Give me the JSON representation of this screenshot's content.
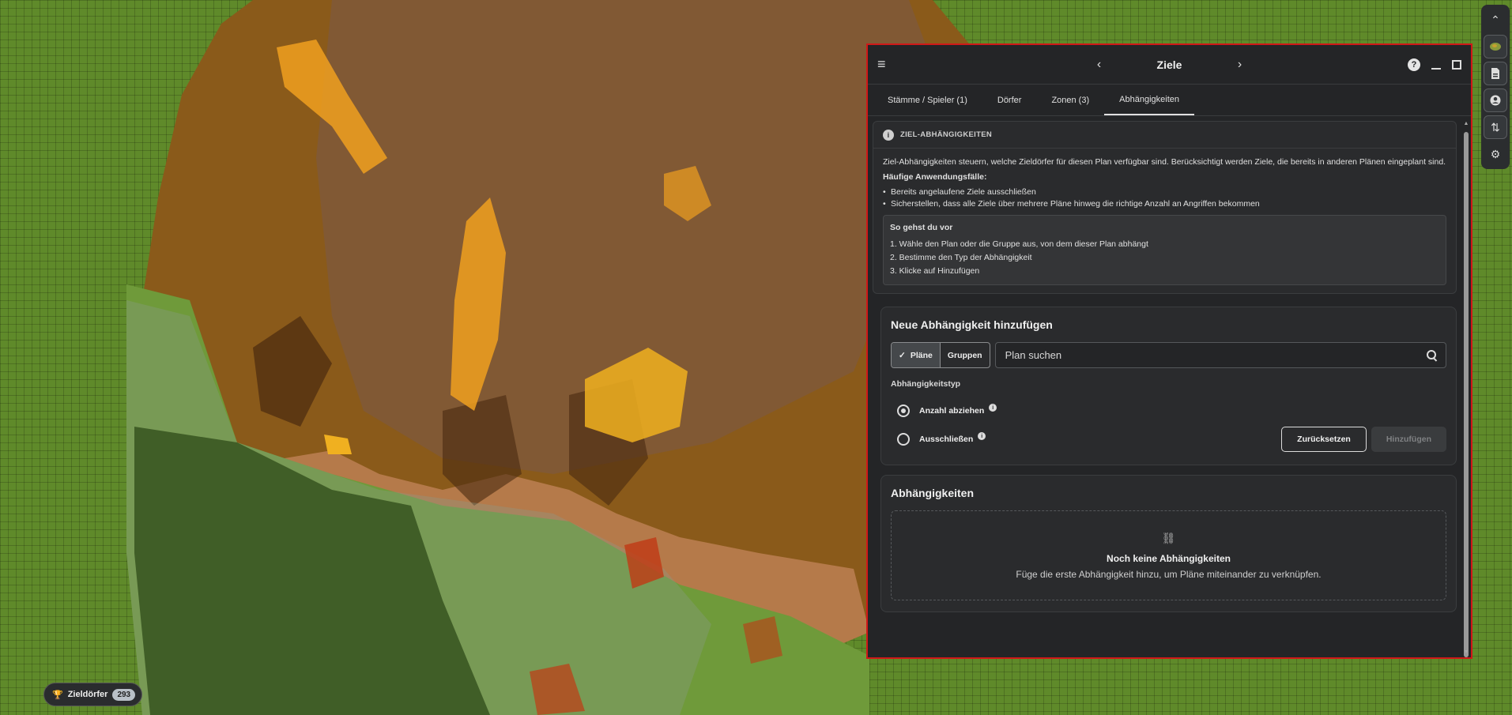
{
  "colors": {
    "panel_border": "#d01818",
    "map_green": "#5f8a2a",
    "map_brown": "#8a5a1a",
    "map_orange": "#f0a020"
  },
  "map_badge": {
    "icon": "trophy-icon",
    "label": "Zieldörfer",
    "count": "293"
  },
  "right_toolbar": {
    "icons": [
      "chevron-up-icon",
      "map-preview-icon",
      "document-icon",
      "account-icon",
      "swap-icon",
      "settings-icon"
    ]
  },
  "panel": {
    "title": "Ziele",
    "tabs": [
      {
        "label": "Stämme / Spieler (1)"
      },
      {
        "label": "Dörfer"
      },
      {
        "label": "Zonen (3)"
      },
      {
        "label": "Abhängigkeiten",
        "active": true
      }
    ],
    "info": {
      "heading": "ZIEL-ABHÄNGIGKEITEN",
      "description": "Ziel-Abhängigkeiten steuern, welche Zieldörfer für diesen Plan verfügbar sind. Berücksichtigt werden Ziele, die bereits in anderen Plänen eingeplant sind.",
      "use_cases_title": "Häufige Anwendungsfälle:",
      "use_cases": [
        "Bereits angelaufene Ziele ausschließen",
        "Sicherstellen, dass alle Ziele über mehrere Pläne hinweg die richtige Anzahl an Angriffen bekommen"
      ],
      "howto_title": "So gehst du vor",
      "steps": [
        "1. Wähle den Plan oder die Gruppe aus, von dem dieser Plan abhängt",
        "2. Bestimme den Typ der Abhängigkeit",
        "3. Klicke auf Hinzufügen"
      ]
    },
    "add_section": {
      "title": "Neue Abhängigkeit hinzufügen",
      "toggle_plans": "Pläne",
      "toggle_groups": "Gruppen",
      "search_placeholder": "Plan suchen",
      "dep_type_label": "Abhängigkeitstyp",
      "option_subtract": "Anzahl abziehen",
      "option_exclude": "Ausschließen",
      "reset_label": "Zurücksetzen",
      "add_label": "Hinzufügen"
    },
    "deps_section": {
      "title": "Abhängigkeiten",
      "empty_title": "Noch keine Abhängigkeiten",
      "empty_sub": "Füge die erste Abhängigkeit hinzu, um Pläne miteinander zu verknüpfen."
    }
  }
}
